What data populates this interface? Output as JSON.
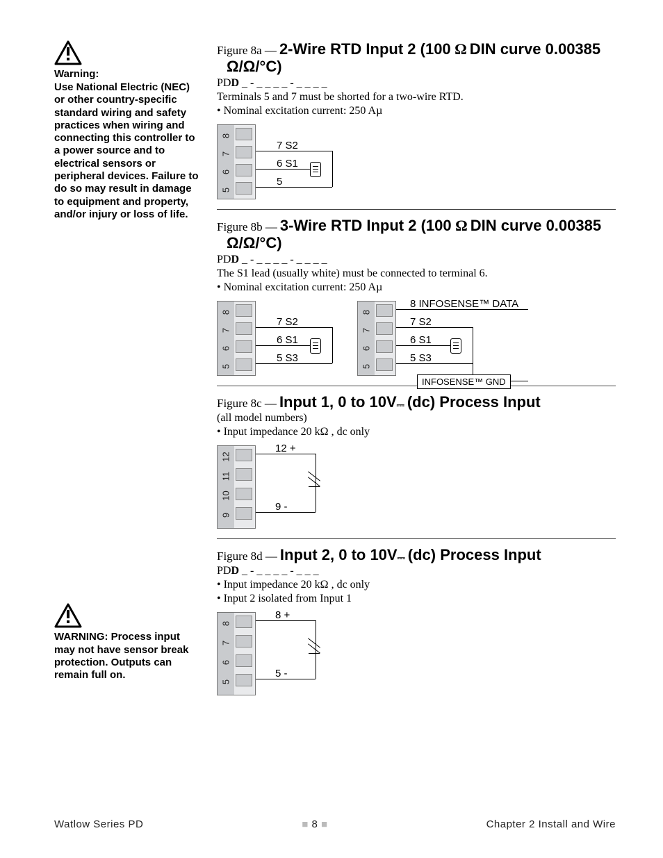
{
  "sidebar": {
    "warning1_head": "Warning:",
    "warning1_body": "Use National Electric (NEC) or other country-specific standard wiring and safety practices when wiring and connecting this controller to a power source and to electrical sensors or peripheral devices. Failure to do so may result in damage to equipment and property, and/or injury or loss of life.",
    "warning2_body": "WARNING: Process input may not have sensor break protection. Outputs can remain full on."
  },
  "fig8a": {
    "label": "Figure 8a —",
    "title_a": "2-Wire RTD Input 2 (100",
    "title_b": " DIN curve 0.00385",
    "title_c": "/ /°C)",
    "model": "PD",
    "model_bold": "D",
    "model_rest": " _ - _  _  _  _ - _  _  _  _",
    "desc": "Terminals 5 and 7 must be shorted for a two-wire RTD.",
    "bullet": "• Nominal excitation current: 250  A",
    "labels": {
      "t7": "7  S2",
      "t6": "6  S1",
      "t5": "5"
    },
    "termnums": [
      "8",
      "7",
      "6",
      "5"
    ]
  },
  "fig8b": {
    "label": "Figure 8b —",
    "title_a": "3-Wire RTD Input 2 (100",
    "title_b": " DIN curve 0.00385",
    "title_c": "/ /°C)",
    "model": "PD",
    "model_bold": "D",
    "model_rest": " _ - _  _  _  _ - _  _  _  _",
    "desc": "The S1 lead (usually white) must be connected to terminal 6.",
    "bullet": "• Nominal excitation current: 250  A",
    "left": {
      "t7": "7  S2",
      "t6": "6  S1",
      "t5": "5  S3"
    },
    "right": {
      "t8": "8  INFOSENSE™ DATA",
      "t7": "7  S2",
      "t6": "6  S1",
      "t5": "5  S3",
      "gnd": "INFOSENSE™ GND"
    },
    "termnums": [
      "8",
      "7",
      "6",
      "5"
    ]
  },
  "fig8c": {
    "label": "Figure 8c —",
    "title": "Input 1, 0 to 10V (dc) Process Input",
    "desc": "(all model numbers)",
    "bullet": "• Input impedance 20 k  , dc only",
    "labels": {
      "t12": "12  +",
      "t9": "9  -"
    },
    "termnums": [
      "12",
      "11",
      "10",
      "9"
    ]
  },
  "fig8d": {
    "label": "Figure 8d —",
    "title": "Input 2, 0 to 10V (dc) Process Input",
    "model": "PD",
    "model_bold": "D",
    "model_rest": " _ - _  _  _  _ - _  _  _",
    "bullet1": "• Input impedance 20 k  , dc only",
    "bullet2": "• Input 2 isolated from Input 1",
    "labels": {
      "t8": "8  +",
      "t5": "5  -"
    },
    "termnums": [
      "8",
      "7",
      "6",
      "5"
    ]
  },
  "footer": {
    "left": "Watlow Series PD",
    "mid_num": "8",
    "right": "Chapter 2 Install and Wire"
  }
}
